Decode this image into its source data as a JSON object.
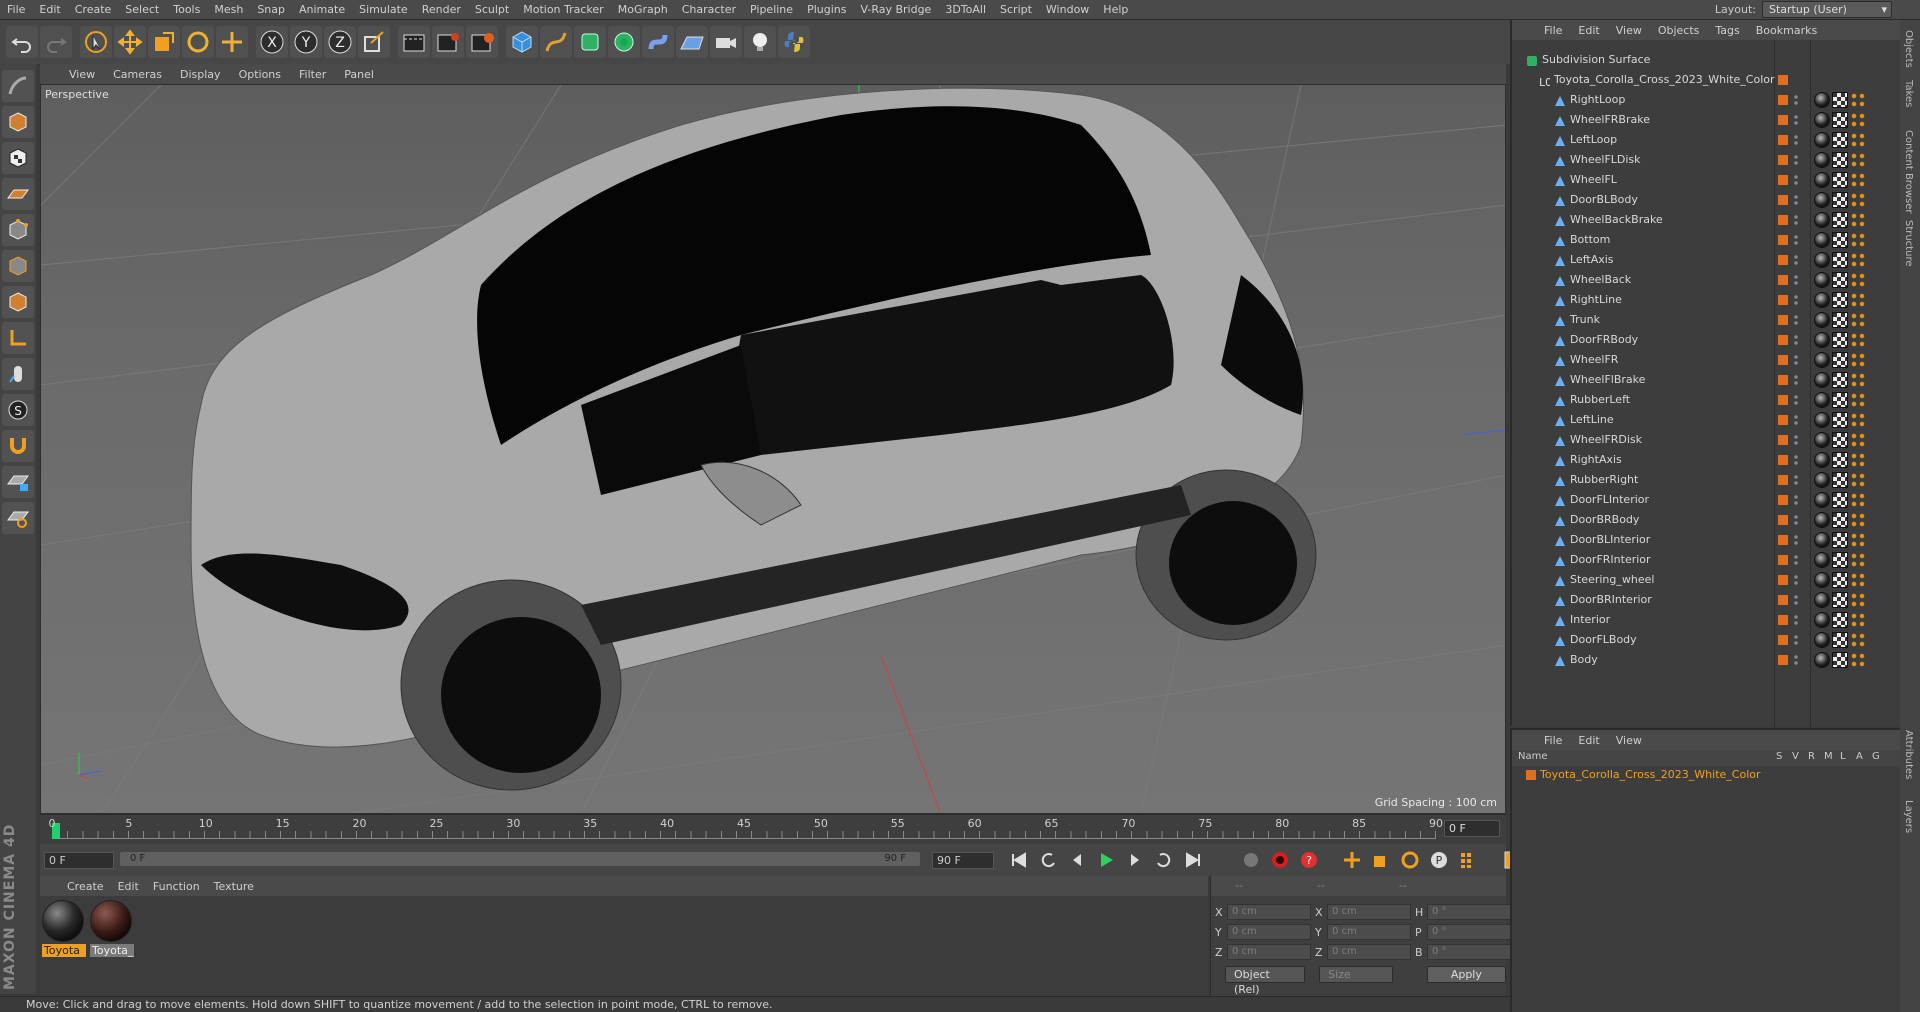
{
  "menubar": {
    "items": [
      "File",
      "Edit",
      "Create",
      "Select",
      "Tools",
      "Mesh",
      "Snap",
      "Animate",
      "Simulate",
      "Render",
      "Sculpt",
      "Motion Tracker",
      "MoGraph",
      "Character",
      "Pipeline",
      "Plugins",
      "V-Ray Bridge",
      "3DToAll",
      "Script",
      "Window",
      "Help"
    ],
    "layout_label": "Layout:",
    "layout_value": "Startup (User)"
  },
  "viewport": {
    "menu": [
      "View",
      "Cameras",
      "Display",
      "Options",
      "Filter",
      "Panel"
    ],
    "label": "Perspective",
    "grid_spacing": "Grid Spacing : 100 cm"
  },
  "timeline": {
    "ticks": [
      "0",
      "5",
      "10",
      "15",
      "20",
      "25",
      "30",
      "35",
      "40",
      "45",
      "50",
      "55",
      "60",
      "65",
      "70",
      "75",
      "80",
      "85",
      "90"
    ],
    "current_frame": "0 F",
    "start_field": "0 F",
    "range_start": "0 F",
    "range_end": "90 F",
    "end_field": "90 F"
  },
  "materials": {
    "menu": [
      "Create",
      "Edit",
      "Function",
      "Texture"
    ],
    "items": [
      {
        "name": "Toyota",
        "selected": true
      },
      {
        "name": "Toyota_",
        "selected": false
      }
    ]
  },
  "coords": {
    "headers": [
      "--",
      "--",
      "--"
    ],
    "rows": [
      {
        "a1": "X",
        "v1": "0 cm",
        "a2": "X",
        "v2": "0 cm",
        "a3": "H",
        "v3": "0 °"
      },
      {
        "a1": "Y",
        "v1": "0 cm",
        "a2": "Y",
        "v2": "0 cm",
        "a3": "P",
        "v3": "0 °"
      },
      {
        "a1": "Z",
        "v1": "0 cm",
        "a2": "Z",
        "v2": "0 cm",
        "a3": "B",
        "v3": "0 °"
      }
    ],
    "mode": "Object (Rel)",
    "size": "Size",
    "apply": "Apply"
  },
  "status": "Move: Click and drag to move elements. Hold down SHIFT to quantize movement / add to the selection in point mode, CTRL to remove.",
  "object_manager": {
    "menu": [
      "File",
      "Edit",
      "View",
      "Objects",
      "Tags",
      "Bookmarks"
    ],
    "root": "Subdivision Surface",
    "group": "Toyota_Corolla_Cross_2023_White_Color",
    "objects": [
      "RightLoop",
      "WheelFRBrake",
      "LeftLoop",
      "WheelFLDisk",
      "WheelFL",
      "DoorBLBody",
      "WheelBackBrake",
      "Bottom",
      "LeftAxis",
      "WheelBack",
      "RightLine",
      "Trunk",
      "DoorFRBody",
      "WheelFR",
      "WheelFlBrake",
      "RubberLeft",
      "LeftLine",
      "WheelFRDisk",
      "RightAxis",
      "RubberRight",
      "DoorFLInterior",
      "DoorBRBody",
      "DoorBLInterior",
      "DoorFRInterior",
      "Steering_wheel",
      "DoorBRInterior",
      "Interior",
      "DoorFLBody",
      "Body"
    ]
  },
  "layer_manager": {
    "menu": [
      "File",
      "Edit",
      "View"
    ],
    "columns": [
      "Name",
      "S",
      "V",
      "R",
      "M",
      "L",
      "A",
      "G"
    ],
    "layer": "Toyota_Corolla_Cross_2023_White_Color"
  },
  "right_tabs": [
    "Objects",
    "Takes",
    "Content Browser",
    "Structure",
    "Attributes",
    "Layers"
  ],
  "brand": "MAXON CINEMA 4D",
  "colors": {
    "accent": "#f0a020",
    "layer": "#e07020",
    "playhead": "#1fd16b"
  }
}
